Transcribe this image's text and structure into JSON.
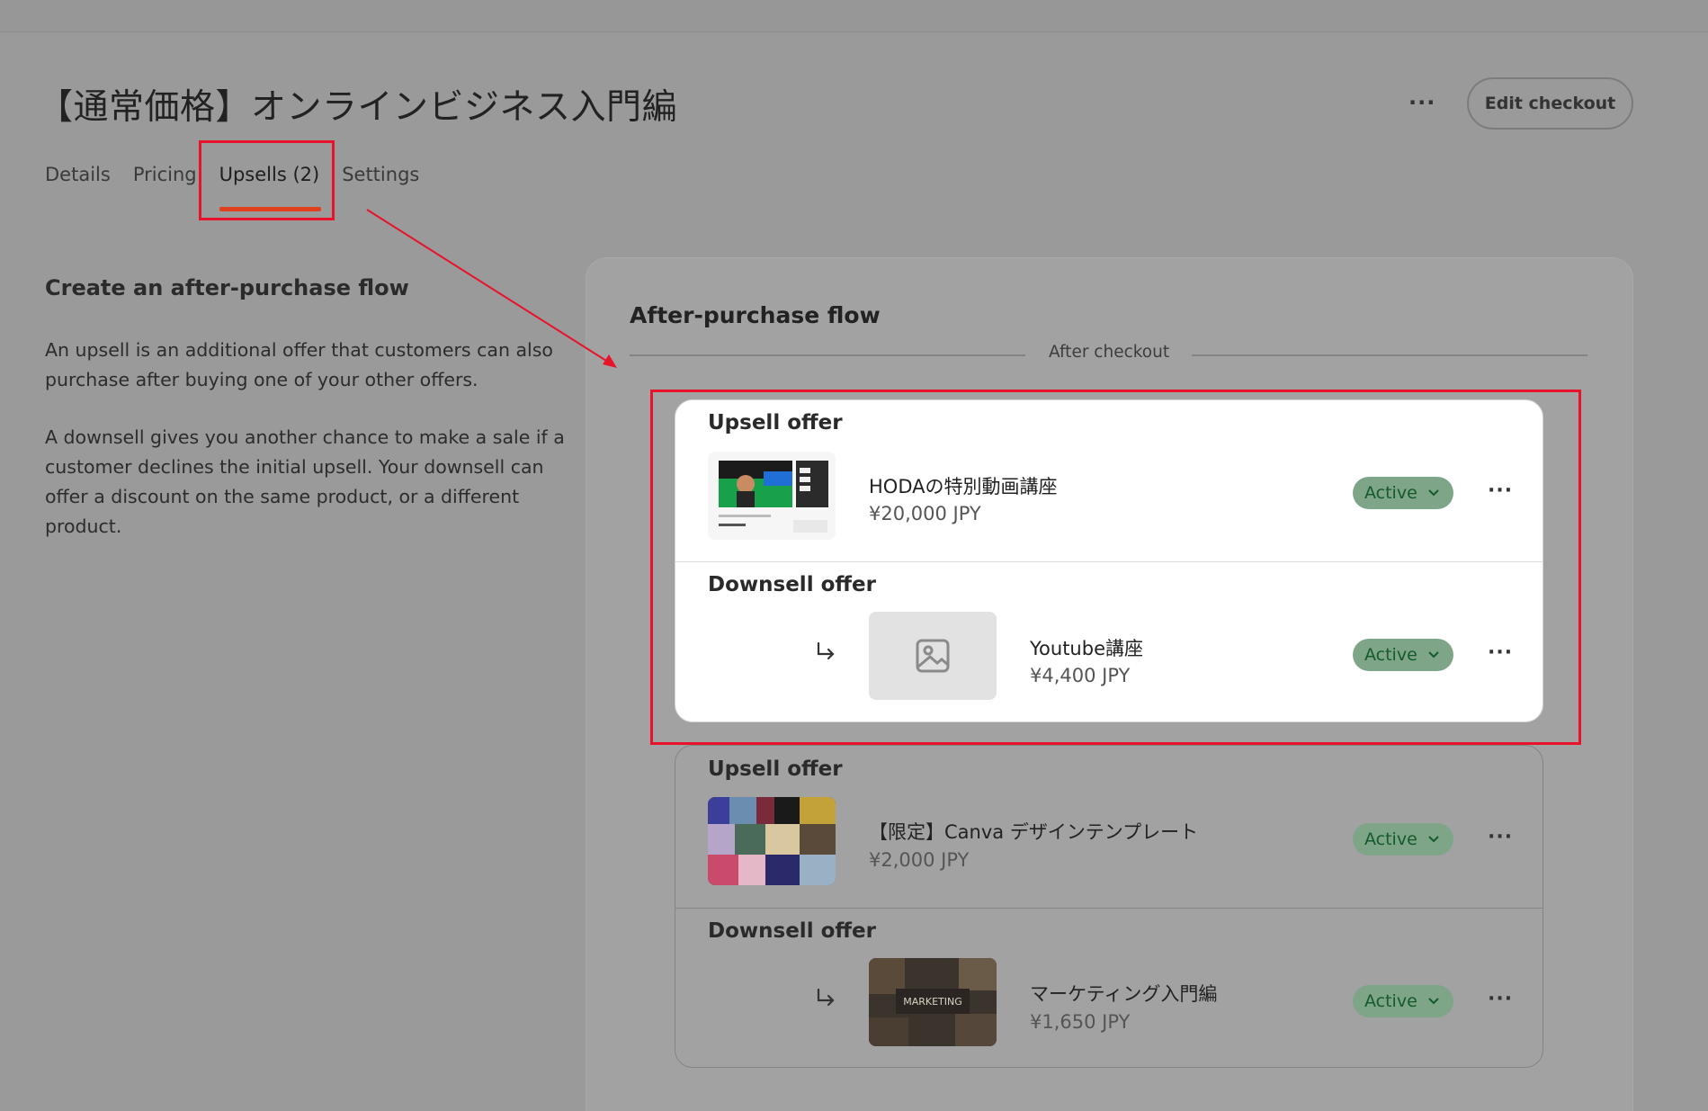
{
  "page": {
    "title": "【通常価格】オンラインビジネス入門編",
    "more_label": "···",
    "edit_checkout_label": "Edit checkout"
  },
  "tabs": [
    {
      "label": "Details"
    },
    {
      "label": "Pricing"
    },
    {
      "label": "Upsells (2)",
      "active": true
    },
    {
      "label": "Settings"
    }
  ],
  "left": {
    "heading": "Create an after-purchase flow",
    "para1": "An upsell is an additional offer that customers can also purchase after buying one of your other offers.",
    "para2": "A downsell gives you another chance to make a sale if a customer declines the initial upsell. Your downsell can offer a discount on the same product, or a different product."
  },
  "flow": {
    "title": "After-purchase flow",
    "separator_label": "After checkout",
    "groups": [
      {
        "upsell": {
          "label": "Upsell offer",
          "name": "HODAの特別動画講座",
          "price": "¥20,000 JPY",
          "status": "Active",
          "thumb": "video-course-thumbnail"
        },
        "downsell": {
          "label": "Downsell offer",
          "name": "Youtube講座",
          "price": "¥4,400 JPY",
          "status": "Active",
          "thumb": "image-placeholder-icon"
        }
      },
      {
        "upsell": {
          "label": "Upsell offer",
          "name": "【限定】Canva デザインテンプレート",
          "price": "¥2,000 JPY",
          "status": "Active",
          "thumb": "canva-templates-collage"
        },
        "downsell": {
          "label": "Downsell offer",
          "name": "マーケティング入門編",
          "price": "¥1,650 JPY",
          "status": "Active",
          "thumb": "marketing-photo"
        }
      }
    ]
  },
  "colors": {
    "highlight": "#e8122a",
    "tab_underline": "#e0401e",
    "badge_bg": "#dff5e3",
    "badge_text": "#156b30"
  }
}
